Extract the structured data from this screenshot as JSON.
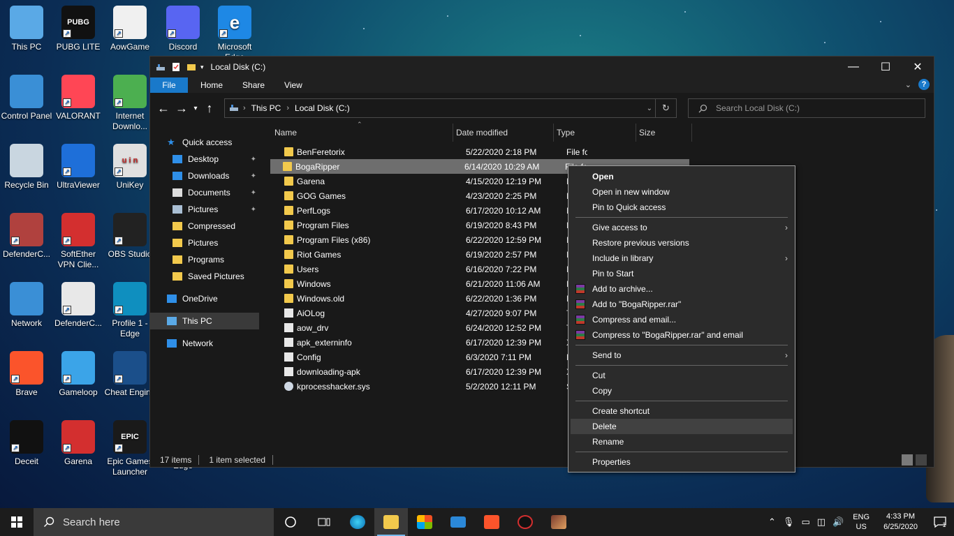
{
  "desktop": {
    "icons": [
      {
        "label": "This PC",
        "color": "#5aa9e6"
      },
      {
        "label": "PUBG LITE",
        "color": "#111111",
        "glyph": "PUBG"
      },
      {
        "label": "AowGame",
        "color": "#f0f0f0"
      },
      {
        "label": "Discord",
        "color": "#5865f2"
      },
      {
        "label": "Microsoft Edge",
        "color": "#1e88e5",
        "glyph": "e"
      },
      {
        "label": "Control Panel",
        "color": "#3a8fd6"
      },
      {
        "label": "VALORANT",
        "color": "#ff4655"
      },
      {
        "label": "Internet Downlo...",
        "color": "#4caf50"
      },
      {
        "label": "Recycle Bin",
        "color": "#c9d6e0"
      },
      {
        "label": "UltraViewer",
        "color": "#1e6fd9"
      },
      {
        "label": "UniKey",
        "color": "#e0e0e0",
        "glyph": "u i n"
      },
      {
        "label": "DefenderC...",
        "color": "#b0413e"
      },
      {
        "label": "SoftEther VPN Clie...",
        "color": "#d32f2f"
      },
      {
        "label": "OBS Studio",
        "color": "#222222"
      },
      {
        "label": "Network",
        "color": "#3a8fd6"
      },
      {
        "label": "DefenderC...",
        "color": "#e8e8e8"
      },
      {
        "label": "Profile 1 - Edge",
        "color": "#0f8fbf"
      },
      {
        "label": "Brave",
        "color": "#fb542b"
      },
      {
        "label": "Gameloop",
        "color": "#3ba4e8"
      },
      {
        "label": "Cheat Engine",
        "color": "#1b4f8a"
      },
      {
        "label": "Deceit",
        "color": "#111111"
      },
      {
        "label": "Garena",
        "color": "#d32f2f"
      },
      {
        "label": "Epic Games Launcher",
        "color": "#1a1a1a",
        "glyph": "EPIC"
      },
      {
        "label": "Edge",
        "color": "#1e88e5"
      }
    ]
  },
  "explorer": {
    "title": "Local Disk (C:)",
    "ribbon_tabs": [
      "File",
      "Home",
      "Share",
      "View"
    ],
    "address": {
      "crumbs": [
        "This PC",
        "Local Disk (C:)"
      ]
    },
    "search_placeholder": "Search Local Disk (C:)",
    "nav": [
      {
        "label": "Quick access",
        "icon": "star-icon"
      },
      {
        "label": "Desktop",
        "icon": "desktop-icon",
        "pinned": true
      },
      {
        "label": "Downloads",
        "icon": "download-icon",
        "pinned": true
      },
      {
        "label": "Documents",
        "icon": "document-icon",
        "pinned": true
      },
      {
        "label": "Pictures",
        "icon": "pictures-icon",
        "pinned": true
      },
      {
        "label": "Compressed",
        "icon": "folder-icon"
      },
      {
        "label": "Pictures",
        "icon": "folder-icon"
      },
      {
        "label": "Programs",
        "icon": "folder-icon"
      },
      {
        "label": "Saved Pictures",
        "icon": "folder-icon"
      },
      {
        "label": "OneDrive",
        "icon": "cloud-icon"
      },
      {
        "label": "This PC",
        "icon": "computer-icon",
        "selected": true
      },
      {
        "label": "Network",
        "icon": "network-icon"
      }
    ],
    "columns": [
      "Name",
      "Date modified",
      "Type",
      "Size"
    ],
    "files": [
      {
        "name": "BenFeretorix",
        "date": "5/22/2020 2:18 PM",
        "type": "File folder",
        "kind": "folder"
      },
      {
        "name": "BogaRipper",
        "date": "6/14/2020 10:29 AM",
        "type": "File folder",
        "kind": "folder",
        "selected": true
      },
      {
        "name": "Garena",
        "date": "4/15/2020 12:19 PM",
        "type": "File folder",
        "kind": "folder"
      },
      {
        "name": "GOG Games",
        "date": "4/23/2020 2:25 PM",
        "type": "File folder",
        "kind": "folder"
      },
      {
        "name": "PerfLogs",
        "date": "6/17/2020 10:12 AM",
        "type": "File folder",
        "kind": "folder"
      },
      {
        "name": "Program Files",
        "date": "6/19/2020 8:43 PM",
        "type": "File folder",
        "kind": "folder"
      },
      {
        "name": "Program Files (x86)",
        "date": "6/22/2020 12:59 PM",
        "type": "File folder",
        "kind": "folder"
      },
      {
        "name": "Riot Games",
        "date": "6/19/2020 2:57 PM",
        "type": "File folder",
        "kind": "folder"
      },
      {
        "name": "Users",
        "date": "6/16/2020 7:22 PM",
        "type": "File folder",
        "kind": "folder"
      },
      {
        "name": "Windows",
        "date": "6/21/2020 11:06 AM",
        "type": "File folder",
        "kind": "folder"
      },
      {
        "name": "Windows.old",
        "date": "6/22/2020 1:36 PM",
        "type": "File folder",
        "kind": "folder"
      },
      {
        "name": "AiOLog",
        "date": "4/27/2020 9:07 PM",
        "type": "Text Document",
        "kind": "file"
      },
      {
        "name": "aow_drv",
        "date": "6/24/2020 12:52 PM",
        "type": "Text Document",
        "kind": "file"
      },
      {
        "name": "apk_externinfo",
        "date": "6/17/2020 12:39 PM",
        "type": "XML Document",
        "kind": "file"
      },
      {
        "name": "Config",
        "date": "6/3/2020 7:11 PM",
        "type": "File",
        "kind": "file"
      },
      {
        "name": "downloading-apk",
        "date": "6/17/2020 12:39 PM",
        "type": "XML Document",
        "kind": "file"
      },
      {
        "name": "kprocesshacker.sys",
        "date": "5/2/2020 12:11 PM",
        "type": "System file",
        "kind": "sys"
      }
    ],
    "status": {
      "count": "17 items",
      "selected": "1 item selected"
    }
  },
  "context_menu": {
    "items": [
      {
        "label": "Open",
        "bold": true
      },
      {
        "label": "Open in new window"
      },
      {
        "label": "Pin to Quick access"
      },
      {
        "sep": true
      },
      {
        "label": "Give access to",
        "submenu": true
      },
      {
        "label": "Restore previous versions"
      },
      {
        "label": "Include in library",
        "submenu": true
      },
      {
        "label": "Pin to Start"
      },
      {
        "label": "Add to archive...",
        "rar": true
      },
      {
        "label": "Add to \"BogaRipper.rar\"",
        "rar": true
      },
      {
        "label": "Compress and email...",
        "rar": true
      },
      {
        "label": "Compress to \"BogaRipper.rar\" and email",
        "rar": true
      },
      {
        "sep": true
      },
      {
        "label": "Send to",
        "submenu": true
      },
      {
        "sep": true
      },
      {
        "label": "Cut"
      },
      {
        "label": "Copy"
      },
      {
        "sep": true
      },
      {
        "label": "Create shortcut"
      },
      {
        "label": "Delete",
        "hover": true
      },
      {
        "label": "Rename"
      },
      {
        "sep": true
      },
      {
        "label": "Properties"
      }
    ]
  },
  "taskbar": {
    "search_placeholder": "Search here",
    "language": "ENG",
    "region": "US",
    "time": "4:33 PM",
    "date": "6/25/2020",
    "notifications": "1"
  }
}
